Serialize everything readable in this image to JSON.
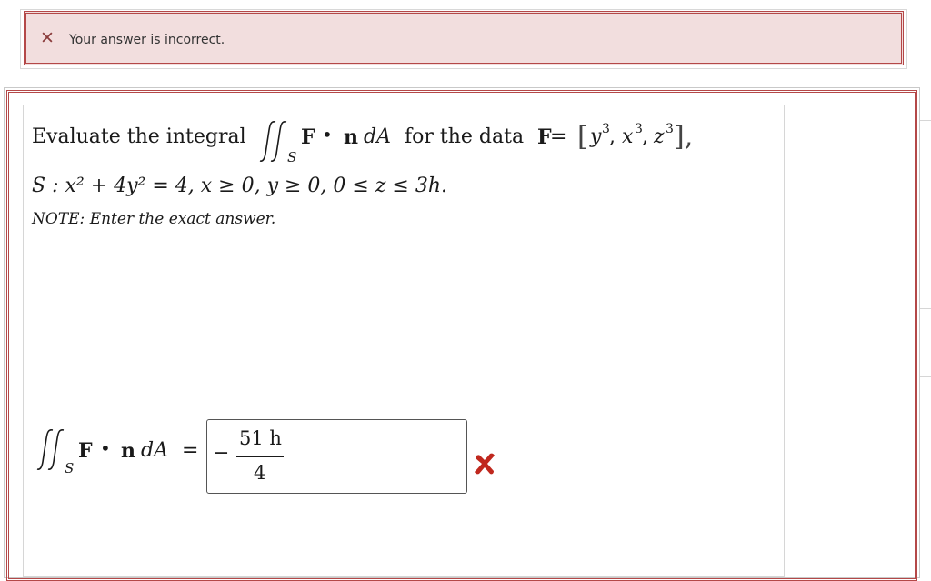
{
  "feedback": {
    "icon": "close-icon",
    "message": "Your answer is incorrect.",
    "background_color": "#f2dede",
    "border_color": "#b44848"
  },
  "question": {
    "intro": "Evaluate the integral",
    "integral_subscript": "S",
    "integrand_F": "F",
    "integrand_dot": "•",
    "integrand_n": "n",
    "integrand_dA": "dA",
    "for_the_data": "for the data",
    "field_label": "F",
    "field_eq": "=",
    "field_open": "[",
    "field_close": "],",
    "field_components": [
      "y",
      "x",
      "z"
    ],
    "field_exponent": "3",
    "surface_line": "S : x² + 4y² = 4, x ≥ 0, y ≥ 0, 0 ≤ z ≤ 3h.",
    "note": "NOTE: Enter the exact answer."
  },
  "answer": {
    "lhs_F": "F",
    "lhs_dot": "•",
    "lhs_n": "n",
    "lhs_dA": "dA",
    "lhs_eq": "=",
    "lhs_subscript": "S",
    "minus": "−",
    "numerator": "51 h",
    "denominator": "4",
    "status_icon": "wrong-x-icon",
    "status_color": "#c0281e"
  }
}
